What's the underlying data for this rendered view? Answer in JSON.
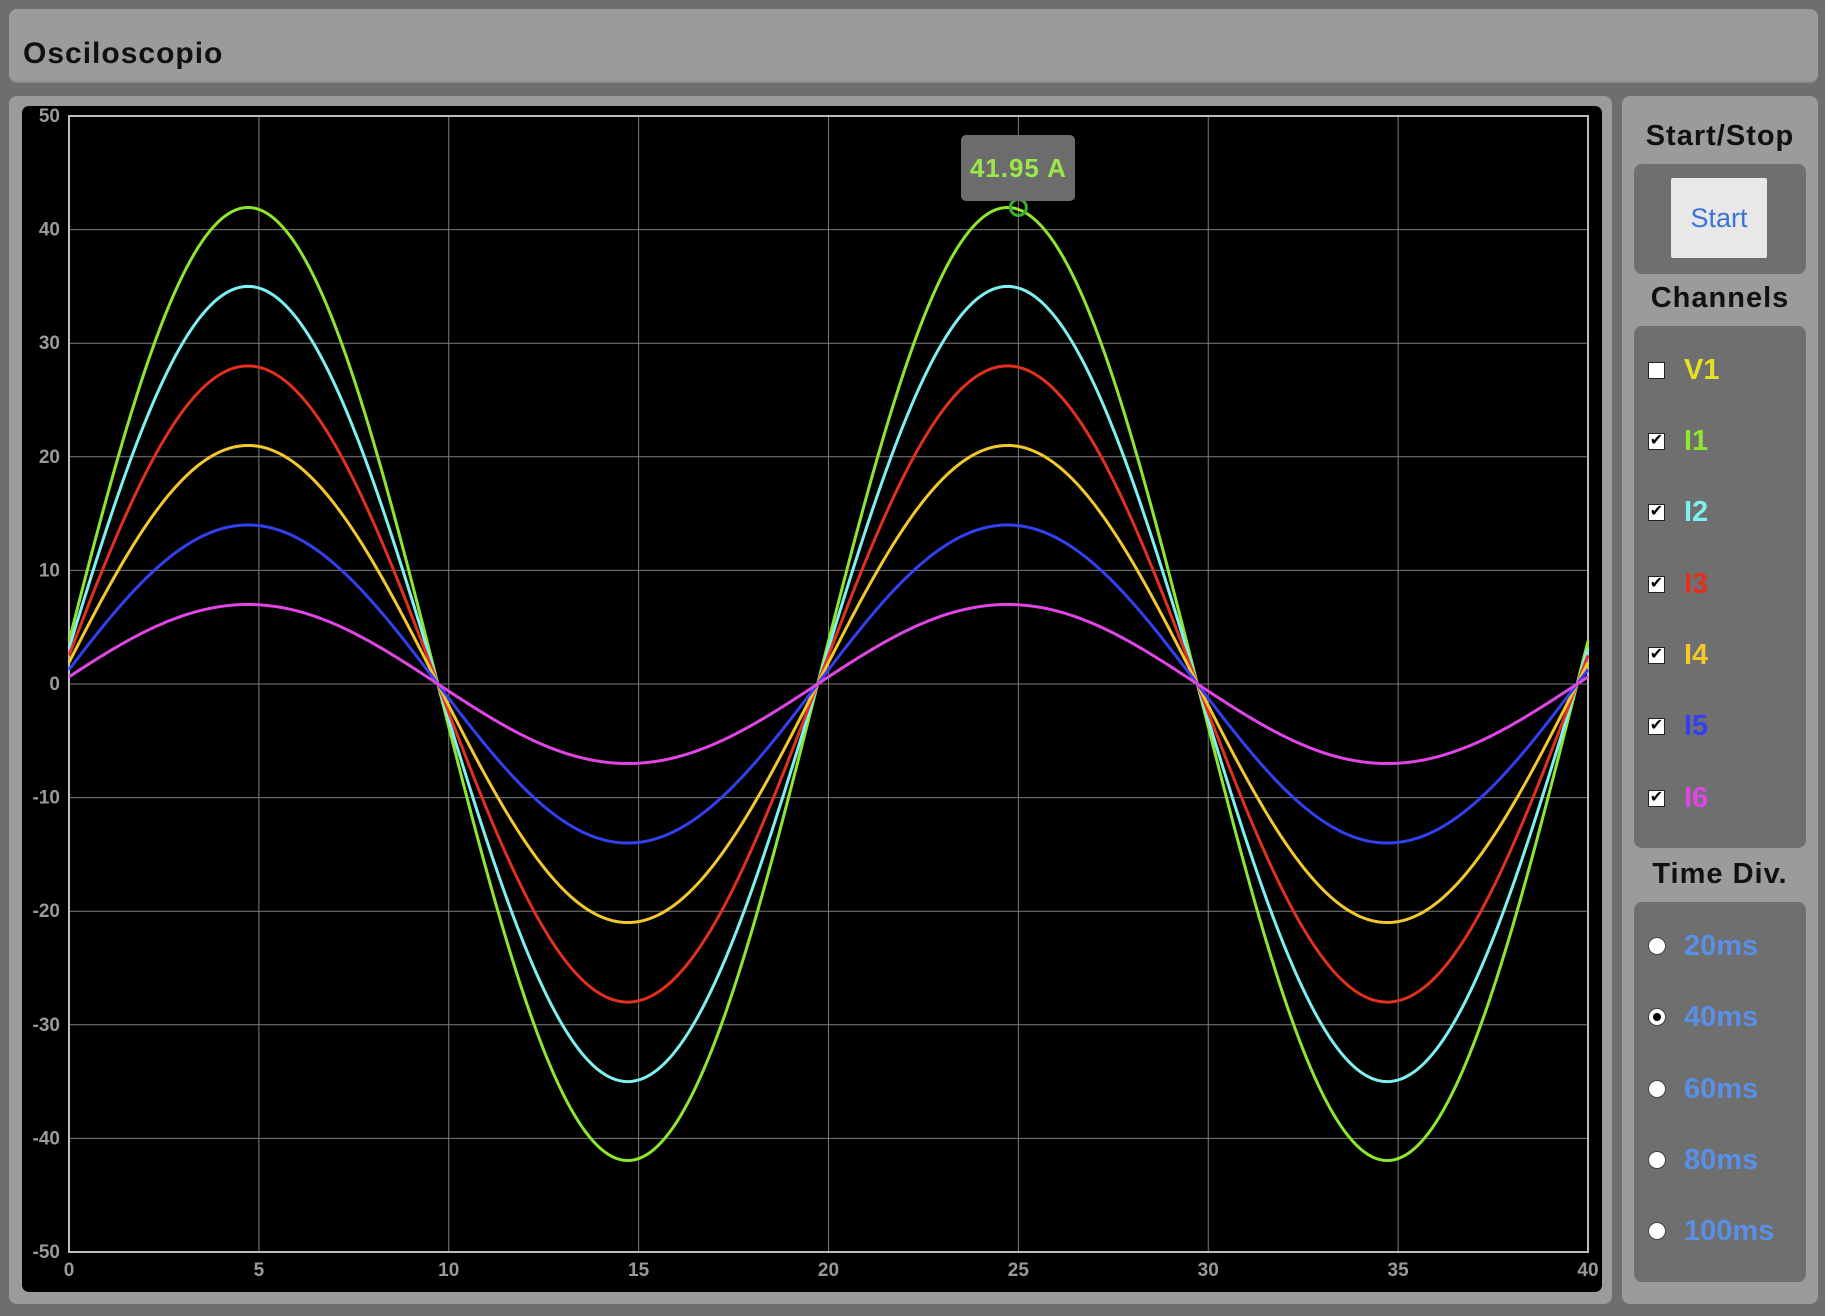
{
  "app": {
    "title": "Osciloscopio"
  },
  "controls": {
    "start_stop_label": "Start/Stop",
    "start_button": "Start",
    "channels_label": "Channels",
    "time_div_label": "Time Div."
  },
  "channels": [
    {
      "name": "V1",
      "checked": false,
      "color": "#e8e021"
    },
    {
      "name": "I1",
      "checked": true,
      "color": "#8ee62e"
    },
    {
      "name": "I2",
      "checked": true,
      "color": "#7ef0f0"
    },
    {
      "name": "I3",
      "checked": true,
      "color": "#e0301e"
    },
    {
      "name": "I4",
      "checked": true,
      "color": "#f2c82c"
    },
    {
      "name": "I5",
      "checked": true,
      "color": "#3340f0"
    },
    {
      "name": "I6",
      "checked": true,
      "color": "#e045e6"
    }
  ],
  "time_divs": [
    {
      "label": "20ms",
      "selected": false
    },
    {
      "label": "40ms",
      "selected": true
    },
    {
      "label": "60ms",
      "selected": false
    },
    {
      "label": "80ms",
      "selected": false
    },
    {
      "label": "100ms",
      "selected": false
    }
  ],
  "tooltip": {
    "text": "41.95 A",
    "x": 25,
    "y": 41.95
  },
  "chart_data": {
    "type": "line",
    "xlim": [
      0,
      40
    ],
    "ylim": [
      -50,
      50
    ],
    "x_ticks": [
      "0",
      "5",
      "10",
      "15",
      "20",
      "25",
      "30",
      "35",
      "40"
    ],
    "y_ticks": [
      "50",
      "40",
      "30",
      "20",
      "10",
      "0",
      "-10",
      "-20",
      "-30",
      "-40",
      "-50"
    ],
    "grid": true,
    "period": 20,
    "phase_offset": 0,
    "series": [
      {
        "name": "I1",
        "amplitude": 41.95,
        "color": "#8ee62e"
      },
      {
        "name": "I2",
        "amplitude": 35,
        "color": "#7ef0f0"
      },
      {
        "name": "I3",
        "amplitude": 28,
        "color": "#e0301e"
      },
      {
        "name": "I4",
        "amplitude": 21,
        "color": "#f2c82c"
      },
      {
        "name": "I5",
        "amplitude": 14,
        "color": "#3340f0"
      },
      {
        "name": "I6",
        "amplitude": 7,
        "color": "#e045e6"
      }
    ]
  }
}
